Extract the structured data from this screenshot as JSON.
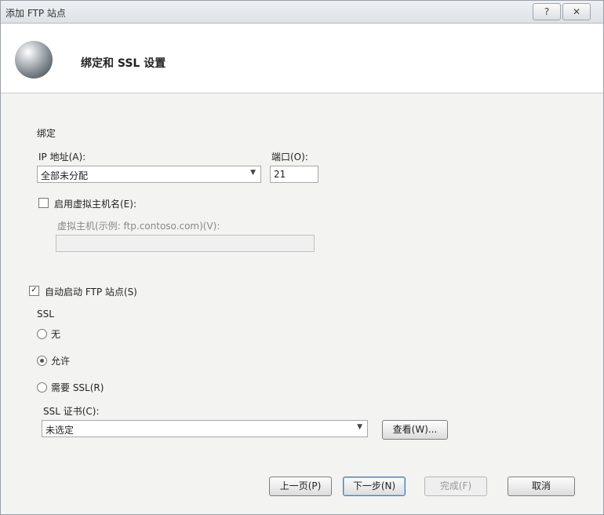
{
  "window": {
    "title": "添加 FTP 站点",
    "help_glyph": "?",
    "close_glyph": "✕"
  },
  "header": {
    "title": "绑定和 SSL 设置",
    "icon": "globe-icon"
  },
  "binding": {
    "section_label": "绑定",
    "ip_label": "IP 地址(A):",
    "ip_value": "全部未分配",
    "port_label": "端口(O):",
    "port_value": "21",
    "virtual_host_checkbox_label": "启用虚拟主机名(E):",
    "virtual_host_checked": false,
    "virtual_host_label": "虚拟主机(示例: ftp.contoso.com)(V):",
    "virtual_host_value": ""
  },
  "autostart": {
    "label": "自动启动 FTP 站点(S)",
    "checked": true
  },
  "ssl": {
    "section_label": "SSL",
    "options": [
      {
        "label": "无",
        "selected": false
      },
      {
        "label": "允许",
        "selected": true
      },
      {
        "label": "需要 SSL(R)",
        "selected": false
      }
    ],
    "cert_label": "SSL 证书(C):",
    "cert_value": "未选定",
    "view_button": "查看(W)..."
  },
  "footer": {
    "prev": "上一页(P)",
    "next": "下一步(N)",
    "finish": "完成(F)",
    "cancel": "取消"
  }
}
